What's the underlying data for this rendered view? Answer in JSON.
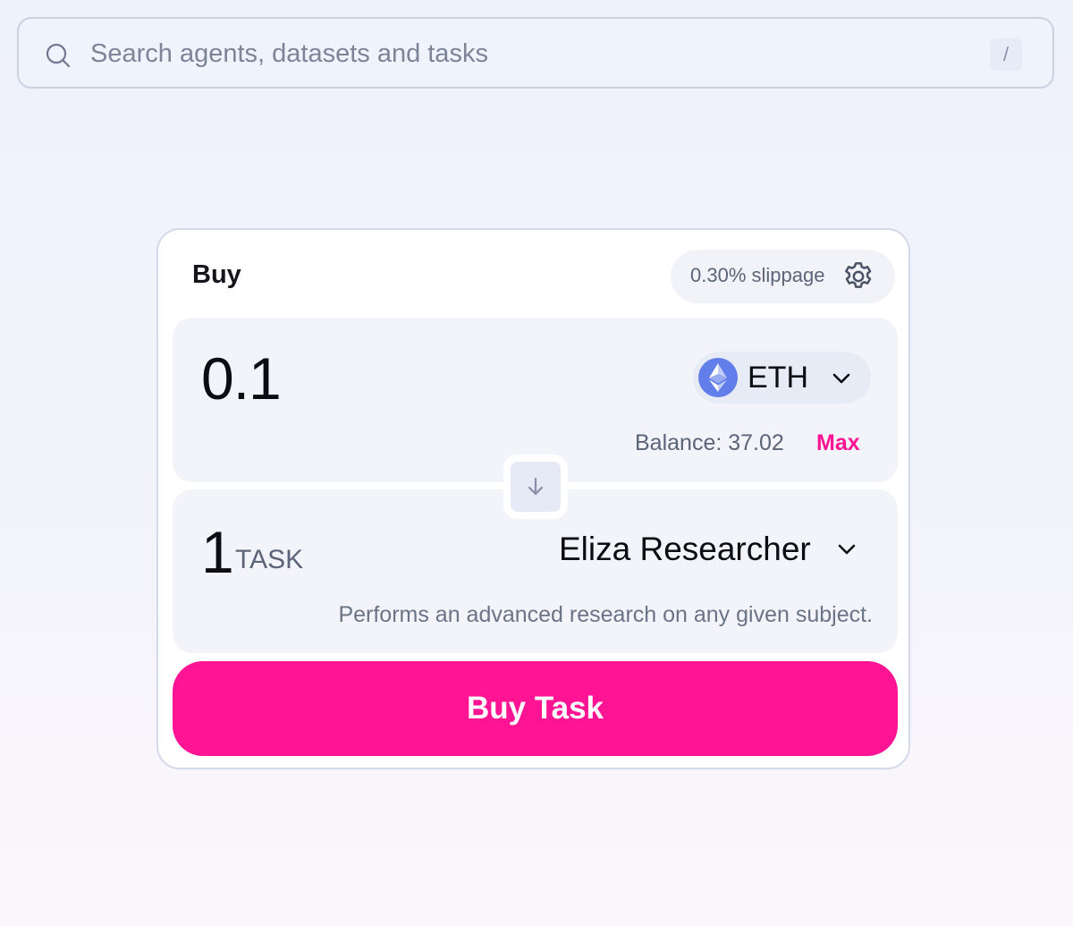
{
  "search": {
    "placeholder": "Search agents, datasets and tasks",
    "value": "",
    "shortcut": "/",
    "icon": "search-icon"
  },
  "card": {
    "title": "Buy",
    "slippage_label": "0.30% slippage",
    "settings_icon": "gear-icon"
  },
  "pay": {
    "amount": "0.1",
    "token_symbol": "ETH",
    "token_icon": "eth-icon",
    "balance_label": "Balance: 37.02",
    "max_label": "Max"
  },
  "receive": {
    "amount": "1",
    "unit": "TASK",
    "agent_name": "Eliza Researcher",
    "agent_description": "Performs an advanced research on any given subject."
  },
  "actions": {
    "buy_label": "Buy Task"
  },
  "colors": {
    "accent": "#ff1493",
    "panel_bg": "#f3f4fa",
    "muted_text": "#5b6478",
    "eth_blue": "#627eea"
  }
}
